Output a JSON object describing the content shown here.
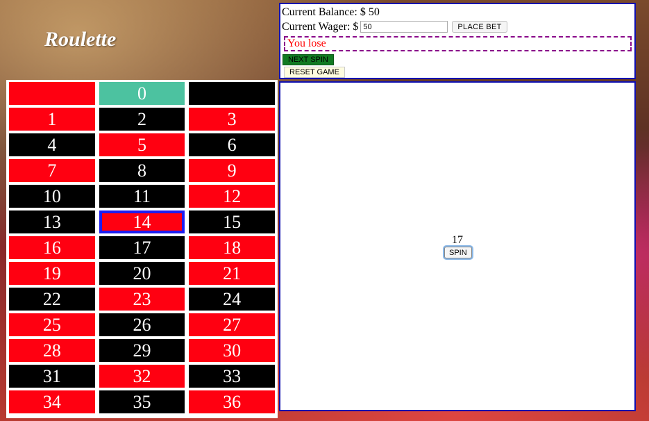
{
  "title": "Roulette",
  "status": {
    "balance_label": "Current Balance: $ 50",
    "wager_label": "Current Wager: $",
    "wager_value": "50",
    "place_bet_label": "PLACE BET",
    "result_text": "You lose",
    "next_spin_label": "NEXT SPIN",
    "reset_label": "RESET GAME"
  },
  "wheel": {
    "result_number": "17",
    "spin_label": "SPIN"
  },
  "colors": {
    "red": "#ff0011",
    "black": "#000000",
    "green": "#4cc2a0",
    "selected_border": "#1d1df0"
  },
  "board": {
    "selected": "14",
    "cells": [
      {
        "label": "",
        "color": "red"
      },
      {
        "label": "0",
        "color": "green"
      },
      {
        "label": "",
        "color": "black"
      },
      {
        "label": "1",
        "color": "red"
      },
      {
        "label": "2",
        "color": "black"
      },
      {
        "label": "3",
        "color": "red"
      },
      {
        "label": "4",
        "color": "black"
      },
      {
        "label": "5",
        "color": "red"
      },
      {
        "label": "6",
        "color": "black"
      },
      {
        "label": "7",
        "color": "red"
      },
      {
        "label": "8",
        "color": "black"
      },
      {
        "label": "9",
        "color": "red"
      },
      {
        "label": "10",
        "color": "black"
      },
      {
        "label": "11",
        "color": "black"
      },
      {
        "label": "12",
        "color": "red"
      },
      {
        "label": "13",
        "color": "black"
      },
      {
        "label": "14",
        "color": "red"
      },
      {
        "label": "15",
        "color": "black"
      },
      {
        "label": "16",
        "color": "red"
      },
      {
        "label": "17",
        "color": "black"
      },
      {
        "label": "18",
        "color": "red"
      },
      {
        "label": "19",
        "color": "red"
      },
      {
        "label": "20",
        "color": "black"
      },
      {
        "label": "21",
        "color": "red"
      },
      {
        "label": "22",
        "color": "black"
      },
      {
        "label": "23",
        "color": "red"
      },
      {
        "label": "24",
        "color": "black"
      },
      {
        "label": "25",
        "color": "red"
      },
      {
        "label": "26",
        "color": "black"
      },
      {
        "label": "27",
        "color": "red"
      },
      {
        "label": "28",
        "color": "red"
      },
      {
        "label": "29",
        "color": "black"
      },
      {
        "label": "30",
        "color": "red"
      },
      {
        "label": "31",
        "color": "black"
      },
      {
        "label": "32",
        "color": "red"
      },
      {
        "label": "33",
        "color": "black"
      },
      {
        "label": "34",
        "color": "red"
      },
      {
        "label": "35",
        "color": "black"
      },
      {
        "label": "36",
        "color": "red"
      }
    ]
  }
}
